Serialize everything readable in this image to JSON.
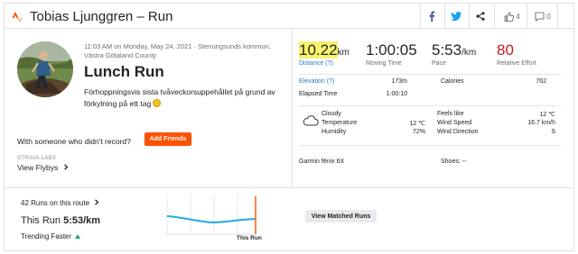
{
  "header": {
    "title": "Tobias Ljunggren – Run",
    "kudos_count": "4",
    "comment_count": "0",
    "colors": {
      "brand": "#fc5200",
      "facebook": "#3b5998",
      "twitter": "#1da1f2"
    }
  },
  "activity": {
    "date_location": "11:03 AM on Monday, May 24, 2021 · Stenungsunds kommun, Västra Götaland County",
    "name": "Lunch Run",
    "description": "Förhoppningsvis sista tvåveckorsuppehållet på grund av förkylning på ett tag"
  },
  "friends": {
    "prompt": "With someone who didn't record?",
    "button": "Add Friends"
  },
  "flybys": {
    "labs_label": "STRAVA LABS",
    "label": "View Flybys"
  },
  "stats": {
    "distance": {
      "value": "10.22",
      "unit": "km",
      "label": "Distance (?)"
    },
    "moving_time": {
      "value": "1:00:05",
      "label": "Moving Time"
    },
    "pace": {
      "value": "5:53",
      "unit": "/km",
      "label": "Pace"
    },
    "relative_effort": {
      "value": "80",
      "label": "Relative Effort",
      "color": "#c4171d"
    }
  },
  "details": {
    "elevation_label": "Elevation (?)",
    "elevation_value": "173m",
    "calories_label": "Calories",
    "calories_value": "762",
    "elapsed_label": "Elapsed Time",
    "elapsed_value": "1:00:10"
  },
  "weather": {
    "icon": "cloud-icon",
    "condition": "Cloudy",
    "temperature_label": "Temperature",
    "temperature_value": "12 ℃",
    "humidity_label": "Humidity",
    "humidity_value": "72%",
    "feels_like_label": "Feels like",
    "feels_like_value": "12 ℃",
    "wind_speed_label": "Wind Speed",
    "wind_speed_value": "16.7 km/h",
    "wind_direction_label": "Wind Direction",
    "wind_direction_value": "S"
  },
  "gear": {
    "device": "Garmin fēnix 6X",
    "shoes": "Shoes: --"
  },
  "route": {
    "runs_count": "42 Runs on this route",
    "this_run_label": "This Run",
    "this_run_pace": "5:53/km",
    "trend": "Trending Faster",
    "chart_label": "This Run",
    "matched_button": "View Matched Runs"
  }
}
